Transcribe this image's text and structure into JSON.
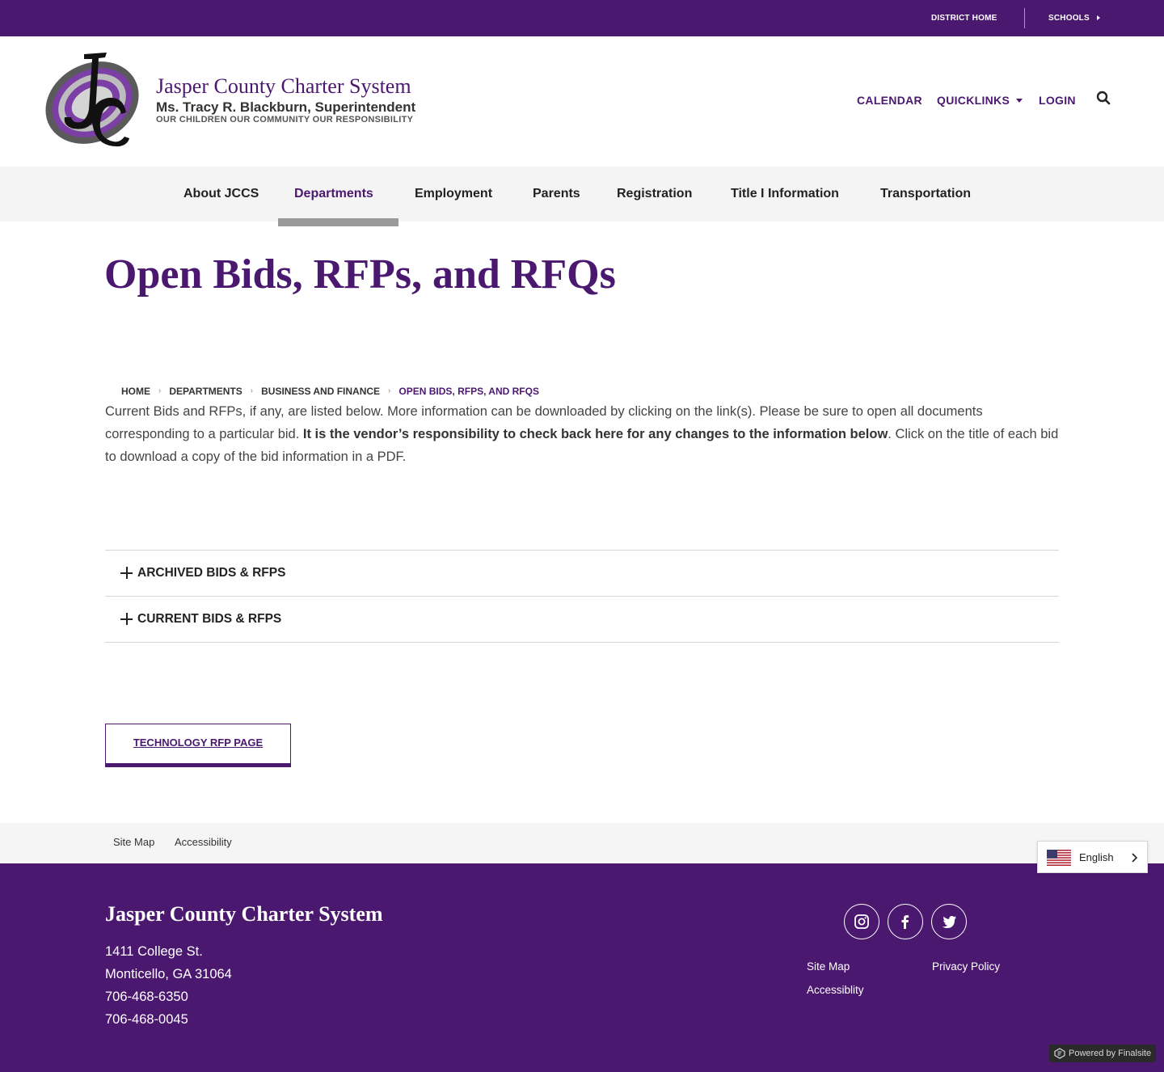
{
  "topbar": {
    "district_home": "DISTRICT HOME",
    "schools": "SCHOOLS"
  },
  "header": {
    "title": "Jasper County Charter System",
    "subtitle": "Ms. Tracy R. Blackburn, Superintendent",
    "tagline": "OUR CHILDREN OUR COMMUNITY OUR RESPONSIBILITY",
    "links": {
      "calendar": "CALENDAR",
      "quicklinks": "QUICKLINKS",
      "login": "LOGIN"
    }
  },
  "nav": {
    "items": [
      "About JCCS",
      "Departments",
      "Employment",
      "Parents",
      "Registration",
      "Title I Information",
      "Transportation"
    ],
    "active_index": 1
  },
  "page": {
    "title": "Open Bids, RFPs, and RFQs",
    "breadcrumb": [
      "HOME",
      "DEPARTMENTS",
      "BUSINESS AND FINANCE",
      "OPEN BIDS, RFPS, AND RFQS"
    ],
    "intro_part1": "Current Bids and RFPs, if any, are listed below. More information can be downloaded by clicking on the link(s). Please be sure to open all documents corresponding to a particular bid. ",
    "intro_bold": "It is the vendor’s responsibility to check back here for any changes to the information below",
    "intro_part2": ". Click on the title of each bid to download a copy of the bid information in a PDF.",
    "accordion": [
      "ARCHIVED BIDS & RFPS",
      "CURRENT BIDS & RFPS"
    ],
    "tech_button": "TECHNOLOGY RFP PAGE"
  },
  "subfooter": {
    "site_map": "Site Map",
    "accessibility": "Accessibility"
  },
  "language": {
    "selected": "English"
  },
  "footer": {
    "title": "Jasper County Charter System",
    "address1": "1411 College St.",
    "address2": "Monticello, GA  31064",
    "phone1": "706-468-6350",
    "phone2": "706-468-0045",
    "links": {
      "site_map": "Site Map",
      "privacy": "Privacy Policy",
      "accessibility": "Accessiblity"
    },
    "powered_by": "Powered by Finalsite"
  },
  "colors": {
    "brand_purple": "#4b1870",
    "nav_bg": "#f4f4f4"
  },
  "icons": [
    "search-icon",
    "caret-right-icon",
    "chevron-down-icon",
    "plus-icon",
    "instagram-icon",
    "facebook-icon",
    "twitter-icon",
    "us-flag-icon",
    "chevron-right-icon",
    "finalsite-icon"
  ]
}
